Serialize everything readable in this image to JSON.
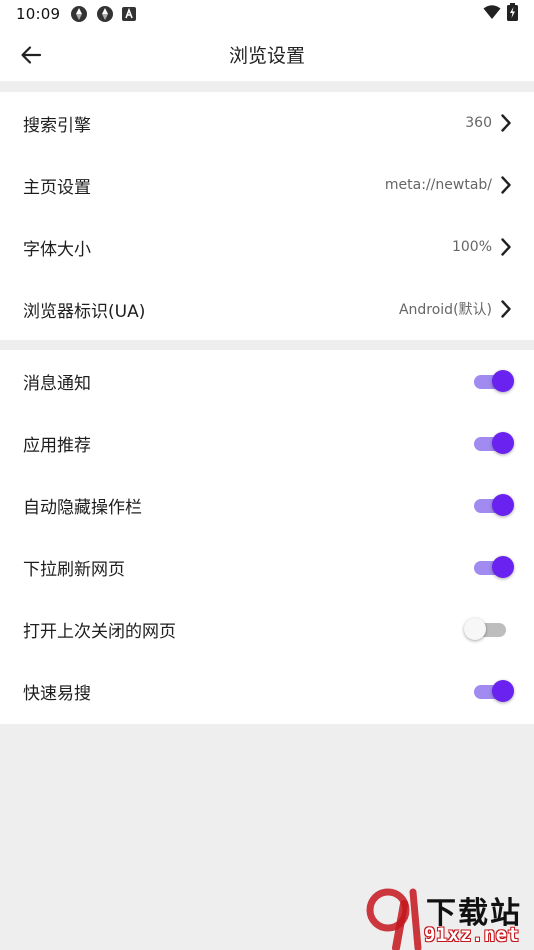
{
  "status_bar": {
    "time": "10:09",
    "icons_left": [
      "sync-icon",
      "sync-icon",
      "a-box-icon"
    ],
    "icons_right": [
      "wifi-icon",
      "battery-charging-icon"
    ]
  },
  "header": {
    "title": "浏览设置",
    "back_icon": "arrow-left-icon"
  },
  "settings": {
    "general": [
      {
        "label": "搜索引擎",
        "value": "360"
      },
      {
        "label": "主页设置",
        "value": "meta://newtab/"
      },
      {
        "label": "字体大小",
        "value": "100%"
      },
      {
        "label": "浏览器标识(UA)",
        "value": "Android(默认)"
      }
    ],
    "toggles": [
      {
        "label": "消息通知",
        "on": true
      },
      {
        "label": "应用推荐",
        "on": true
      },
      {
        "label": "自动隐藏操作栏",
        "on": true
      },
      {
        "label": "下拉刷新网页",
        "on": true
      },
      {
        "label": "打开上次关闭的网页",
        "on": false
      },
      {
        "label": "快速易搜",
        "on": true
      }
    ]
  },
  "watermark": {
    "top_text": "下载站",
    "bottom_text": "91xz.net"
  },
  "colors": {
    "accent": "#6a22f0",
    "accent_track": "#a18bf0",
    "background": "#eeeeee",
    "surface": "#ffffff",
    "watermark_red": "#c4161c"
  }
}
